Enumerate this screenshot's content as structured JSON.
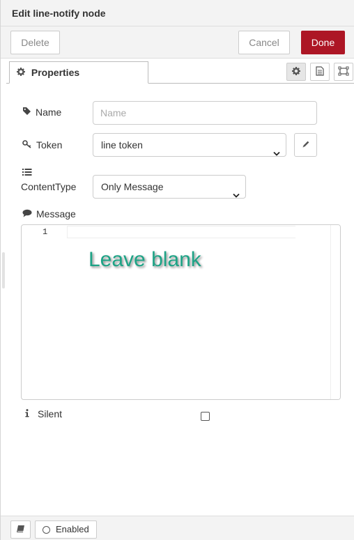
{
  "header": {
    "title": "Edit line-notify node"
  },
  "toolbar": {
    "delete_label": "Delete",
    "cancel_label": "Cancel",
    "done_label": "Done"
  },
  "tabs": {
    "properties_label": "Properties"
  },
  "form": {
    "name": {
      "label": "Name",
      "placeholder": "Name",
      "value": ""
    },
    "token": {
      "label": "Token",
      "selected": "line token"
    },
    "content_type": {
      "label": "ContentType",
      "selected": "Only Message"
    },
    "message": {
      "label": "Message",
      "line_number": "1",
      "value": ""
    },
    "silent": {
      "label": "Silent",
      "checked": false
    }
  },
  "annotation": {
    "text": "Leave blank"
  },
  "footer": {
    "enabled_label": "Enabled"
  },
  "icons": [
    "gear-icon",
    "description-icon",
    "appearance-icon",
    "tag-icon",
    "key-icon",
    "list-icon",
    "comment-icon",
    "pencil-icon",
    "info-icon",
    "book-icon",
    "circle-icon",
    "chevron-down-icon"
  ],
  "colors": {
    "done_button": "#ad1625",
    "annotation": "#1ea386"
  }
}
